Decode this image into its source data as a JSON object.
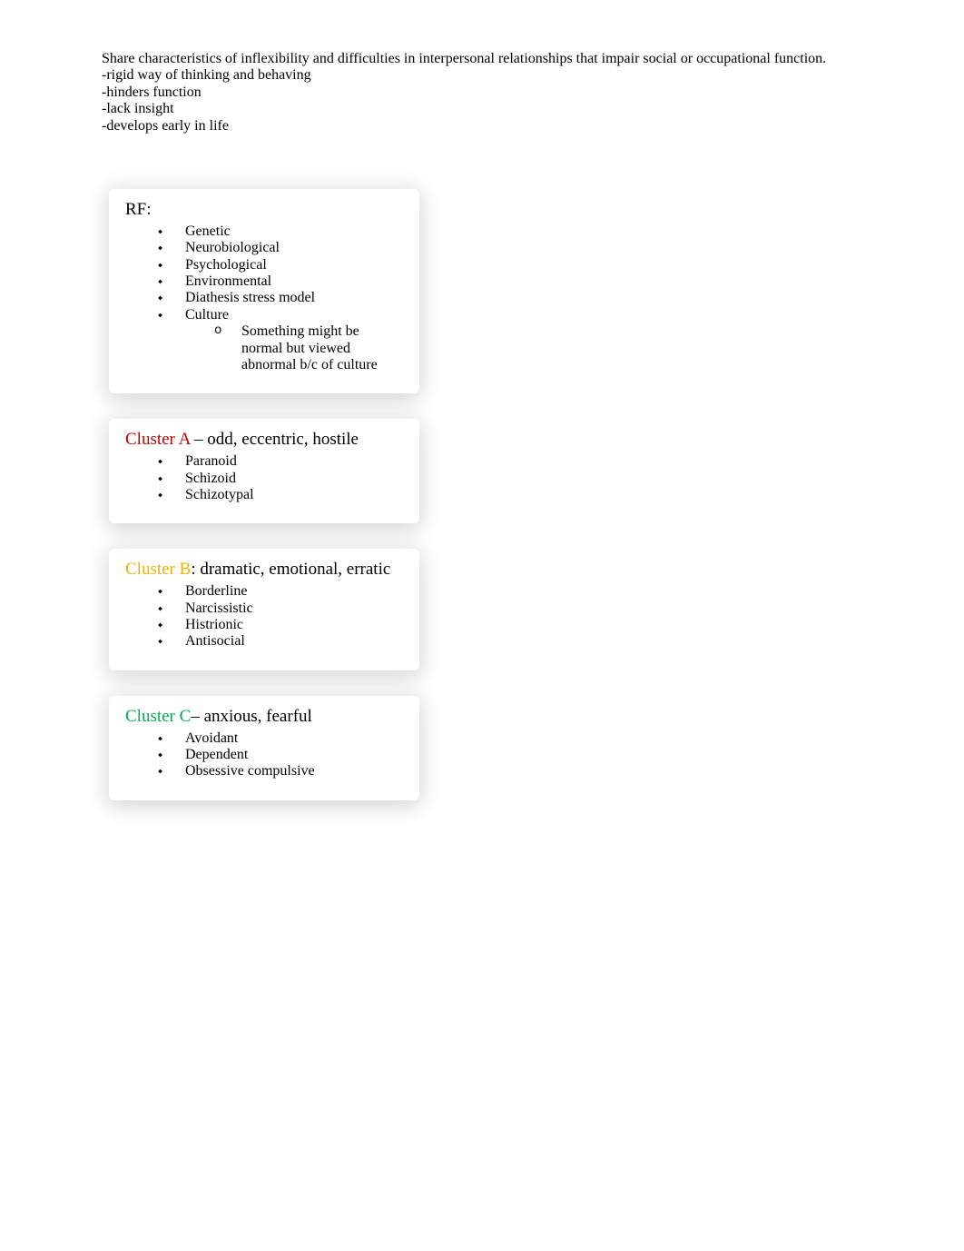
{
  "intro": {
    "line1": "Share characteristics of inflexibility and difficulties in interpersonal relationships that impair social or occupational function.",
    "line2": "-rigid way of thinking and behaving",
    "line3": "-hinders function",
    "line4": "-lack insight",
    "line5": "-develops early in life"
  },
  "boxes": {
    "rf": {
      "title_label": "RF:",
      "title_desc": "",
      "label_color": "#000000",
      "items": [
        "Genetic",
        "Neurobiological",
        "Psychological",
        "Environmental",
        "Diathesis stress model",
        "Culture"
      ],
      "culture_sub": [
        "Something might be normal but viewed abnormal b/c of culture"
      ]
    },
    "cluster_a": {
      "title_label": "Cluster A",
      "title_desc": " – odd, eccentric, hostile",
      "label_color": "#c00000",
      "items": [
        "Paranoid",
        "Schizoid",
        "Schizotypal"
      ]
    },
    "cluster_b": {
      "title_label": "Cluster B",
      "title_desc": ": dramatic, emotional, erratic",
      "label_color": "#e9b300",
      "items": [
        "Borderline",
        "Narcissistic",
        "Histrionic",
        "Antisocial"
      ]
    },
    "cluster_c": {
      "title_label": "Cluster C",
      "title_desc": "– anxious, fearful",
      "label_color": "#00b050",
      "items": [
        "Avoidant",
        "Dependent",
        "Obsessive compulsive"
      ]
    }
  }
}
